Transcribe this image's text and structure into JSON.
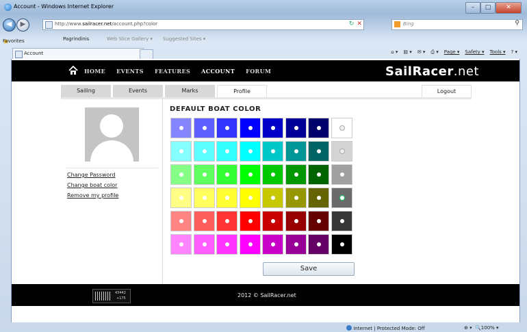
{
  "browser": {
    "window_title": "Account - Windows Internet Explorer",
    "url_prefix": "http://www.",
    "url_domain": "sailracer.net",
    "url_path": "/account.php?color",
    "search_placeholder": "Bing",
    "favorites_label": "Favorites",
    "fav_items": [
      "Pagrindinis",
      "Web Slice Gallery ▾",
      "Suggested Sites ▾"
    ],
    "tab_label": "Account",
    "cmd_items": [
      "Page ▾",
      "Safety ▾",
      "Tools ▾"
    ],
    "status_zone": "Internet | Protected Mode: Off",
    "zoom": "100%"
  },
  "site": {
    "nav": [
      "HOME",
      "EVENTS",
      "FEATURES",
      "ACCOUNT",
      "FORUM"
    ],
    "active_nav": "ACCOUNT",
    "logo_a": "Sail",
    "logo_b": "Racer",
    "logo_c": ".net",
    "subtabs": [
      "Sailing",
      "Events",
      "Marks",
      "Profile"
    ],
    "selected_subtab": "Profile",
    "logout": "Logout",
    "links": [
      "Change Password",
      "Change boat color",
      "Remove my profile"
    ],
    "color_title": "DEFAULT BOAT COLOR",
    "save_label": "Save",
    "stats_top": "43442",
    "stats_bottom": "+175",
    "copyright": "2012 © SailRacer.net"
  },
  "palette": {
    "selected_row": 3,
    "selected_col": 7,
    "rows": [
      [
        "#8585ff",
        "#5f5fff",
        "#3434ff",
        "#0000ff",
        "#0000c8",
        "#000096",
        "#00006a",
        "#ffffff"
      ],
      [
        "#85ffff",
        "#5effff",
        "#34ffff",
        "#00ffff",
        "#00c8c8",
        "#009696",
        "#006464",
        "#d4d4d4"
      ],
      [
        "#85ff85",
        "#5eff5e",
        "#34ff34",
        "#00ff00",
        "#00c800",
        "#009600",
        "#006400",
        "#a0a0a0"
      ],
      [
        "#ffff85",
        "#ffff5e",
        "#ffff34",
        "#ffff00",
        "#c8c800",
        "#969600",
        "#646400",
        "#6a6a6a"
      ],
      [
        "#ff8585",
        "#ff5e5e",
        "#ff3434",
        "#ff0000",
        "#c80000",
        "#960000",
        "#640000",
        "#363636"
      ],
      [
        "#ff85ff",
        "#ff5eff",
        "#ff34ff",
        "#ff00ff",
        "#c800c8",
        "#960096",
        "#640064",
        "#000000"
      ]
    ]
  }
}
